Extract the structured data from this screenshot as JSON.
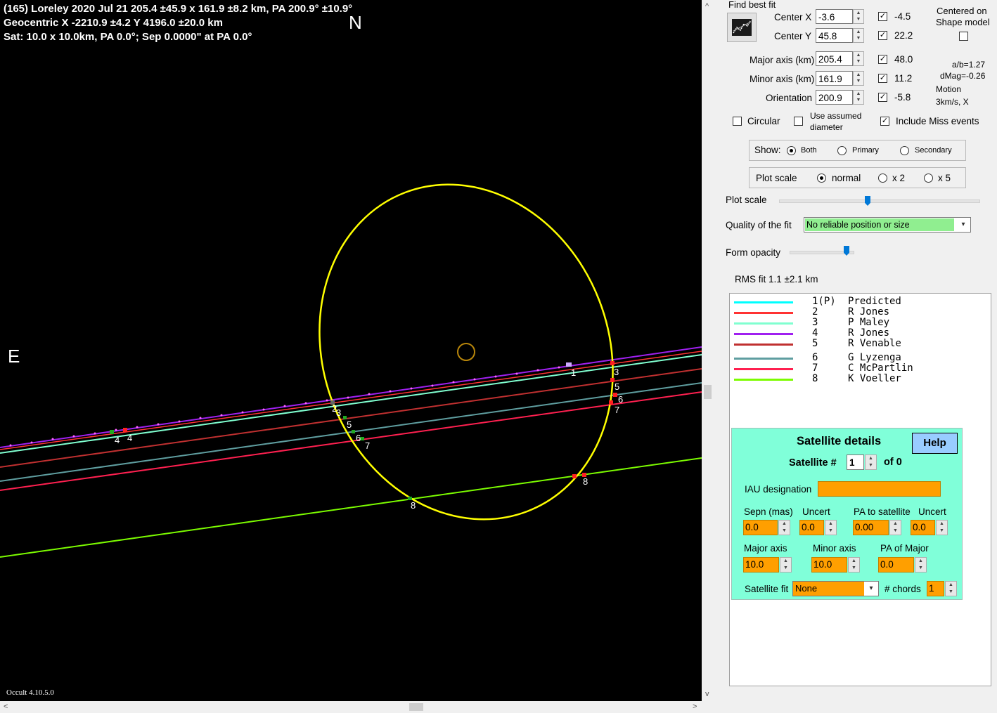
{
  "header": {
    "line1": "(165) Loreley  2020 Jul 21   205.4 ±45.9 x 161.9 ±8.2 km, PA 200.9° ±10.9°",
    "line2": "Geocentric  X  -2210.9 ±4.2  Y 4196.0 ±20.0 km",
    "line3": "Sat:  10.0 x 10.0km, PA 0.0°; Sep 0.0000\" at PA 0.0°"
  },
  "plot": {
    "north": "N",
    "east": "E",
    "version": "Occult 4.10.5.0",
    "ellipse_color": "#ffff00",
    "chord_labels": [
      "1",
      "2",
      "3",
      "4",
      "4",
      "5",
      "5",
      "6",
      "6",
      "7",
      "7",
      "8",
      "8",
      "3"
    ]
  },
  "fit": {
    "find_best_fit": "Find best fit",
    "center_x_label": "Center X",
    "center_x": "-3.6",
    "center_x_unc": "-4.5",
    "center_y_label": "Center Y",
    "center_y": "45.8",
    "center_y_unc": "22.2",
    "centered_on": "Centered on",
    "shape_model": "Shape model",
    "major_label": "Major axis (km)",
    "major": "205.4",
    "major_unc": "48.0",
    "minor_label": "Minor axis (km)",
    "minor": "161.9",
    "minor_unc": "11.2",
    "orient_label": "Orientation",
    "orient": "200.9",
    "orient_unc": "-5.8",
    "ab_ratio": "a/b=1.27",
    "dmag": "dMag=-0.26",
    "motion": "Motion",
    "motion_val": "3km/s, X",
    "circular": "Circular",
    "use_assumed": "Use assumed",
    "diameter": "diameter",
    "include_miss": "Include Miss events",
    "check_mark": "✓"
  },
  "show": {
    "label": "Show:",
    "both": "Both",
    "primary": "Primary",
    "secondary": "Secondary"
  },
  "plotscale": {
    "label": "Plot scale",
    "normal": "normal",
    "x2": "x 2",
    "x5": "x 5",
    "slider_label": "Plot scale",
    "slider_value": 0.45
  },
  "quality": {
    "label": "Quality of the fit",
    "value": "No reliable position or size",
    "color": "#90ee90"
  },
  "opacity": {
    "label": "Form opacity",
    "value": 0.95
  },
  "rms": "RMS fit 1.1 ±2.1 km",
  "legend": [
    {
      "id": "1(P)",
      "name": "Predicted",
      "color": "#00ffff"
    },
    {
      "id": "2",
      "name": "R Jones",
      "color": "#ff3333"
    },
    {
      "id": "3",
      "name": "P Maley",
      "color": "#80ffd0"
    },
    {
      "id": "4",
      "name": "R Jones",
      "color": "#a020f0"
    },
    {
      "id": "5",
      "name": "R Venable",
      "color": "#c03030"
    },
    {
      "id": "6",
      "name": "G Lyzenga",
      "color": "#5f9ea0"
    },
    {
      "id": "7",
      "name": "C McPartlin",
      "color": "#ff2050"
    },
    {
      "id": "8",
      "name": "K Voeller",
      "color": "#7cfc00"
    }
  ],
  "satellite": {
    "title": "Satellite details",
    "help": "Help",
    "sat_label": "Satellite #",
    "sat_num": "1",
    "of": "of 0",
    "iau": "IAU designation",
    "iau_value": "",
    "sepn_label": "Sepn (mas)",
    "uncert_label": "Uncert",
    "pa_label": "PA to satellite",
    "uncert2_label": "Uncert",
    "sepn": "0.0",
    "sepn_unc": "0.0",
    "pa": "0.00",
    "pa_unc": "0.0",
    "major_label": "Major axis",
    "minor_label": "Minor axis",
    "pamajor_label": "PA of Major",
    "major": "10.0",
    "minor": "10.0",
    "pamajor": "0.0",
    "fit_label": "Satellite fit",
    "fit_value": "None",
    "chords_label": "# chords",
    "chords": "1"
  },
  "icons": {
    "find_fit": "graph-fit-icon",
    "up": "▲",
    "down": "▼",
    "dropdown": "▾",
    "left": "<",
    "right": ">",
    "scroll_up": "^",
    "scroll_down": "v"
  }
}
